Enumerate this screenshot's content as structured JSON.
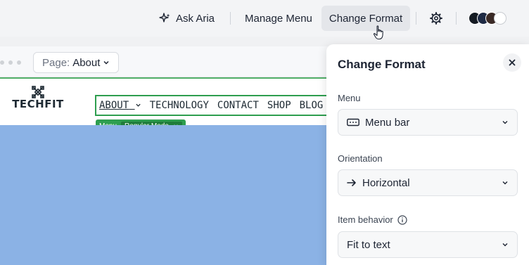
{
  "toolbar": {
    "ask_aria_label": "Ask Aria",
    "manage_menu_label": "Manage Menu",
    "change_format_label": "Change Format",
    "palette_colors": [
      "#141a22",
      "#1e2a44",
      "#3a2a26",
      "#ffffff"
    ]
  },
  "editor": {
    "page_prefix": "Page:",
    "page_name": "About"
  },
  "site": {
    "logo_text": "TECHFIT",
    "menu_items": [
      {
        "label": "ABOUT"
      },
      {
        "label": "TECHNOLOGY"
      },
      {
        "label": "CONTACT"
      },
      {
        "label": "SHOP"
      },
      {
        "label": "BLOG"
      }
    ],
    "menu_chip_label": "Menu",
    "menu_chip_mode": "Regular Mode",
    "hero_color": "#8bb2e5"
  },
  "panel": {
    "title": "Change Format",
    "menu_label": "Menu",
    "menu_value": "Menu bar",
    "orientation_label": "Orientation",
    "orientation_value": "Horizontal",
    "item_behavior_label": "Item behavior",
    "item_behavior_value": "Fit to text"
  },
  "colors": {
    "accent_green": "#2e9e4f"
  }
}
